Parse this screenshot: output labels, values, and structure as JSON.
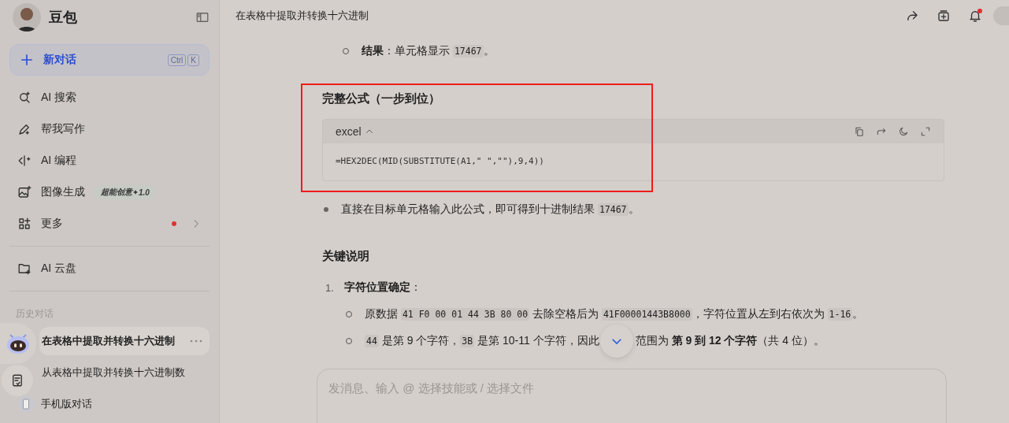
{
  "sidebar": {
    "app_name": "豆包",
    "new_chat": {
      "label": "新对话",
      "shortcut": [
        "Ctrl",
        "K"
      ]
    },
    "nav": [
      {
        "kind": "search",
        "label": "AI 搜索"
      },
      {
        "kind": "write",
        "label": "帮我写作"
      },
      {
        "kind": "code",
        "label": "AI 编程"
      },
      {
        "kind": "image",
        "label": "图像生成",
        "badge": "超能创意",
        "badge_version": "1.0"
      },
      {
        "kind": "more",
        "label": "更多",
        "notification": true
      }
    ],
    "cloud": {
      "label": "AI 云盘"
    },
    "history_heading": "历史对话",
    "history": [
      {
        "kind": "chat",
        "title": "在表格中提取并转换十六进制",
        "selected": true
      },
      {
        "kind": "chat",
        "title": "从表格中提取并转换十六进制数",
        "selected": false
      },
      {
        "kind": "mobile",
        "title": "手机版对话",
        "selected": false
      }
    ]
  },
  "header": {
    "title": "在表格中提取并转换十六进制",
    "notification": true
  },
  "content": [
    {
      "kind": "sub_bullet",
      "parts": [
        {
          "kind": "bold",
          "text": "结果"
        },
        {
          "kind": "plain",
          "text": "：单元格显示 "
        },
        {
          "kind": "code",
          "text": "17467"
        },
        {
          "kind": "plain",
          "text": "。"
        }
      ]
    },
    {
      "kind": "heading",
      "text": "完整公式（一步到位）"
    },
    {
      "kind": "code",
      "language": "excel",
      "code": "=HEX2DEC(MID(SUBSTITUTE(A1,\" \",\"\"),9,4))"
    },
    {
      "kind": "bullet",
      "parts": [
        {
          "kind": "plain",
          "text": "直接在目标单元格输入此公式，即可得到十进制结果 "
        },
        {
          "kind": "code",
          "text": "17467"
        },
        {
          "kind": "plain",
          "text": "。"
        }
      ]
    },
    {
      "kind": "heading",
      "text": "关键说明"
    },
    {
      "kind": "numbered",
      "number": "1.",
      "parts": [
        {
          "kind": "bold",
          "text": "字符位置确定"
        },
        {
          "kind": "plain",
          "text": "："
        }
      ],
      "children": [
        {
          "parts": [
            {
              "kind": "plain",
              "text": "原数据 "
            },
            {
              "kind": "code",
              "text": "41 F0 00 01 44 3B 80 00"
            },
            {
              "kind": "plain",
              "text": " 去除空格后为 "
            },
            {
              "kind": "code",
              "text": "41F00001443B8000"
            },
            {
              "kind": "plain",
              "text": "，字符位置从左到右依次为 "
            },
            {
              "kind": "code",
              "text": "1-16"
            },
            {
              "kind": "plain",
              "text": "。"
            }
          ]
        },
        {
          "parts": [
            {
              "kind": "code",
              "text": "44"
            },
            {
              "kind": "plain",
              "text": " 是第 9 个字符，"
            },
            {
              "kind": "code",
              "text": "3B"
            },
            {
              "kind": "plain",
              "text": " 是第 10-11 个字符，因此"
            }
          ],
          "parts_after_button": [
            {
              "kind": "plain",
              "text": "范围为 "
            },
            {
              "kind": "bold",
              "text": "第 9 到 12 个字符"
            },
            {
              "kind": "plain",
              "text": "（共 4 位）。"
            }
          ]
        }
      ]
    }
  ],
  "composer": {
    "placeholder": "发消息、输入 @ 选择技能或 / 选择文件"
  }
}
